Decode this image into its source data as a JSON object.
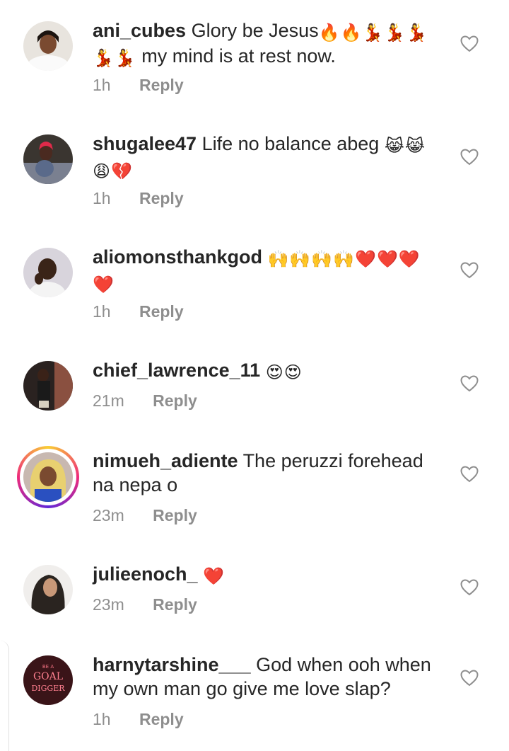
{
  "comments": [
    {
      "username": "ani_cubes",
      "text": "Glory be Jesus",
      "emoji": "🔥🔥💃💃💃",
      "emoji2": "💃💃",
      "text2": "my mind is at rest now.",
      "time": "1h",
      "reply": "Reply"
    },
    {
      "username": "shugalee47",
      "text": "Life no balance abeg",
      "emoji": "😹😹",
      "emoji2": "😩💔",
      "time": "1h",
      "reply": "Reply"
    },
    {
      "username": "aliomonsthankgod",
      "emoji": "🙌🙌🙌🙌❤️❤️❤️",
      "emoji2": "❤️",
      "time": "1h",
      "reply": "Reply"
    },
    {
      "username": "chief_lawrence_11",
      "emoji": "😍😍",
      "time": "21m",
      "reply": "Reply"
    },
    {
      "username": "nimueh_adiente",
      "text": "The peruzzi forehead",
      "text2": "na nepa o",
      "time": "23m",
      "reply": "Reply"
    },
    {
      "username": "julieenoch_",
      "emoji": "❤️",
      "time": "23m",
      "reply": "Reply"
    },
    {
      "username": "harnytarshine___",
      "text": "God when ooh when",
      "text2": "my own man go give me love slap?",
      "time": "1h",
      "reply": "Reply"
    }
  ],
  "avatar_signs": {
    "line1": "BE A",
    "line2": "GOAL",
    "line3": "DIGGER"
  },
  "colors": {
    "meta": "#8e8e8e",
    "text": "#262626",
    "heart_stroke": "#8e8e8e"
  },
  "icons": {
    "like": "heart-outline-icon"
  }
}
